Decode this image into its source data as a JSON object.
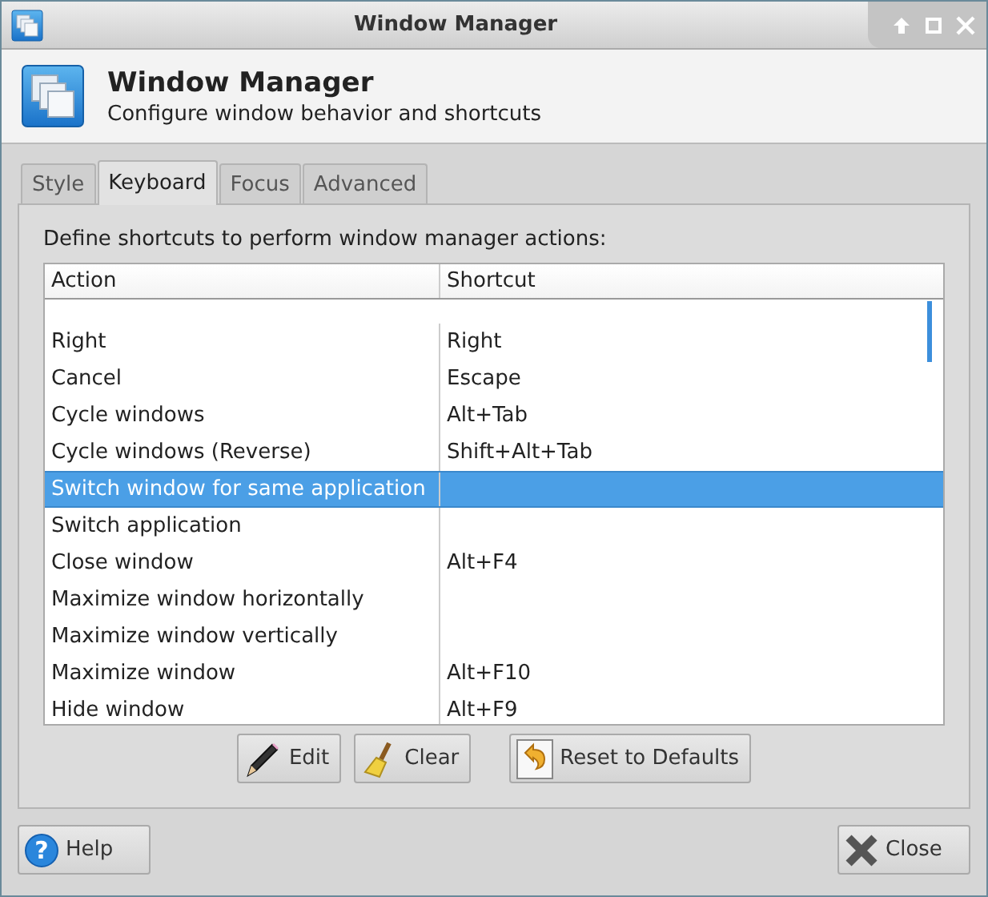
{
  "window": {
    "title": "Window Manager"
  },
  "header": {
    "title": "Window Manager",
    "subtitle": "Configure window behavior and shortcuts"
  },
  "tabs": [
    {
      "label": "Style",
      "selected": false
    },
    {
      "label": "Keyboard",
      "selected": true
    },
    {
      "label": "Focus",
      "selected": false
    },
    {
      "label": "Advanced",
      "selected": false
    }
  ],
  "instruction": "Define shortcuts to perform window manager actions:",
  "table": {
    "columns": [
      "Action",
      "Shortcut"
    ],
    "rows": [
      {
        "action": "Right",
        "shortcut": "Right",
        "selected": false
      },
      {
        "action": "Cancel",
        "shortcut": "Escape",
        "selected": false
      },
      {
        "action": "Cycle windows",
        "shortcut": "Alt+Tab",
        "selected": false
      },
      {
        "action": "Cycle windows (Reverse)",
        "shortcut": "Shift+Alt+Tab",
        "selected": false
      },
      {
        "action": "Switch window for same application",
        "shortcut": "",
        "selected": true
      },
      {
        "action": "Switch application",
        "shortcut": "",
        "selected": false
      },
      {
        "action": "Close window",
        "shortcut": "Alt+F4",
        "selected": false
      },
      {
        "action": "Maximize window horizontally",
        "shortcut": "",
        "selected": false
      },
      {
        "action": "Maximize window vertically",
        "shortcut": "",
        "selected": false
      },
      {
        "action": "Maximize window",
        "shortcut": "Alt+F10",
        "selected": false
      },
      {
        "action": "Hide window",
        "shortcut": "Alt+F9",
        "selected": false
      }
    ]
  },
  "actions": [
    {
      "kind": "edit",
      "label": "Edit"
    },
    {
      "kind": "clear",
      "label": "Clear"
    },
    {
      "kind": "reset",
      "label": "Reset to Defaults"
    }
  ],
  "help": {
    "icon": "?",
    "label": "Help"
  },
  "close": {
    "label": "Close"
  }
}
